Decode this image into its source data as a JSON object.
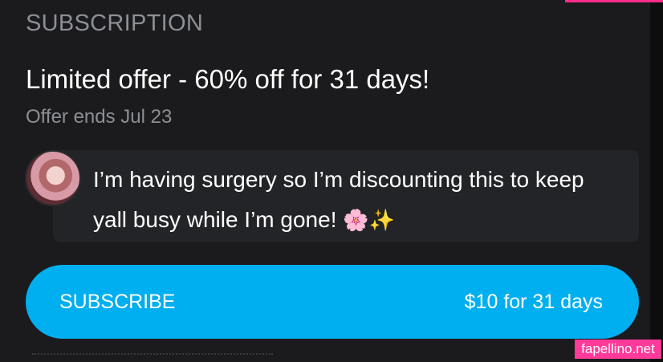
{
  "section_label": "SUBSCRIPTION",
  "offer": {
    "title": "Limited offer - 60% off for 31 days!",
    "ends": "Offer ends Jul 23"
  },
  "message": {
    "text": "I’m having surgery so I’m discounting this to keep yall busy while I’m gone!",
    "emoji": "🌸✨"
  },
  "subscribe": {
    "label": "SUBSCRIBE",
    "price": "$10 for 31 days"
  },
  "watermark": "fapellino.net",
  "colors": {
    "accent": "#00aff0",
    "background": "#1b1b1d",
    "watermark": "#ff3a9a"
  }
}
